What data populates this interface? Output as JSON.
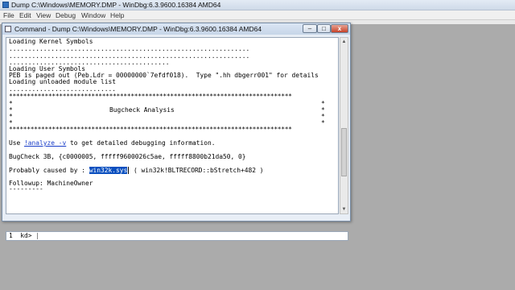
{
  "app": {
    "title": "Dump C:\\Windows\\MEMORY.DMP - WinDbg:6.3.9600.16384 AMD64"
  },
  "menu": [
    "File",
    "Edit",
    "View",
    "Debug",
    "Window",
    "Help"
  ],
  "command_window": {
    "title": "Command - Dump C:\\Windows\\MEMORY.DMP - WinDbg:6.3.9600.16384 AMD64",
    "buttons": {
      "minimize": "–",
      "maximize": "□",
      "close": "x"
    }
  },
  "output": {
    "loading_kernel": "Loading Kernel Symbols",
    "kernel_dots_1": "...............................................................",
    "kernel_dots_2": "...............................................................",
    "kernel_dots_3": "..........................................",
    "loading_user": "Loading User Symbols",
    "peb_line": "PEB is paged out (Peb.Ldr = 00000000`7efdf018).  Type \".hh dbgerr001\" for details",
    "loading_unloaded": "Loading unloaded module list",
    "unloaded_dots": "............................",
    "stars": "*******************************************************************************",
    "side_star_left": "*",
    "side_star_right": "*",
    "bugcheck_heading": "Bugcheck Analysis",
    "use_prefix": "Use ",
    "analyze_link": "!analyze -v",
    "use_suffix": " to get detailed debugging information.",
    "bugcheck_line": "BugCheck 3B, {c0000005, fffff9600026c5ae, fffff8800b21da50, 0}",
    "caused_prefix": "Probably caused by : ",
    "caused_module": "win32k.sys",
    "caused_suffix": " ( win32k!BLTRECORD::bStretch+482 )",
    "followup": "Followup: MachineOwner",
    "followup_underline": "---------"
  },
  "prompt": {
    "label": "1  kd>",
    "value": ""
  }
}
